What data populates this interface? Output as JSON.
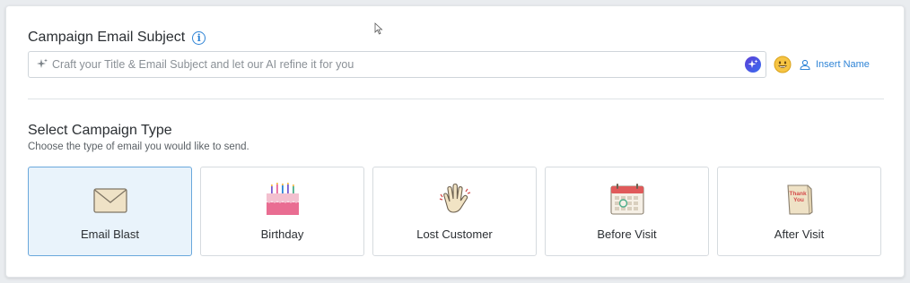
{
  "subject": {
    "title": "Campaign Email Subject",
    "info_icon": "info-icon",
    "placeholder": "Craft your Title & Email Subject and let our AI refine it for you",
    "value": "",
    "ai_icon": "ai-sparkle-icon",
    "emoji_icon": "emoji-icon",
    "insert_name_label": "Insert Name",
    "accent_color": "#2f84d6"
  },
  "campaign_type": {
    "title": "Select Campaign Type",
    "subtitle": "Choose the type of email you would like to send.",
    "selected": "Email Blast",
    "cards": [
      {
        "label": "Email Blast",
        "icon": "envelope-icon"
      },
      {
        "label": "Birthday",
        "icon": "birthday-cake-icon"
      },
      {
        "label": "Lost Customer",
        "icon": "waving-hand-icon"
      },
      {
        "label": "Before Visit",
        "icon": "calendar-icon"
      },
      {
        "label": "After Visit",
        "icon": "thank-you-card-icon"
      }
    ],
    "thank_you_text_1": "Thank",
    "thank_you_text_2": "You"
  }
}
